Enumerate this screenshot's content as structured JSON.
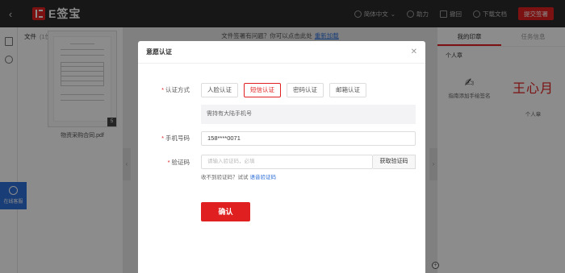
{
  "topbar": {
    "logo_text": "E签宝",
    "language": "简体中文",
    "assist": "助力",
    "tools": "撤回",
    "download": "下载文档",
    "submit_label": "提交签署"
  },
  "files": {
    "title": "文件",
    "count": "(1份)",
    "file_name": "物资采购合同.pdf",
    "page_badge": "5"
  },
  "notice": {
    "text": "文件签署有问题？你可以点击此处",
    "link": "重新加载"
  },
  "online_service": "在线客服",
  "right_panel": {
    "tabs": [
      "我的印章",
      "任务信息"
    ],
    "section": "个人章",
    "hand_sign_hint": "指南添加手绘签名",
    "seal_name": "王心月",
    "seal_caption": "个人章"
  },
  "modal": {
    "title": "意愿认证",
    "method_label": "认证方式",
    "methods": [
      "人脸认证",
      "短信认证",
      "密码认证",
      "邮箱认证"
    ],
    "active_method": "短信认证",
    "hint": "需持有大陆手机号",
    "phone_label": "手机号码",
    "phone_value": "158****0071",
    "code_label": "验证码",
    "code_placeholder": "请输入验证码，必填",
    "get_code": "获取验证码",
    "help_text": "收不到验证码？试试",
    "help_link": "语音验证码",
    "confirm": "确认"
  },
  "colors": {
    "accent": "#e02020",
    "link": "#2e6fd8",
    "topbar": "#2b2b2b"
  }
}
